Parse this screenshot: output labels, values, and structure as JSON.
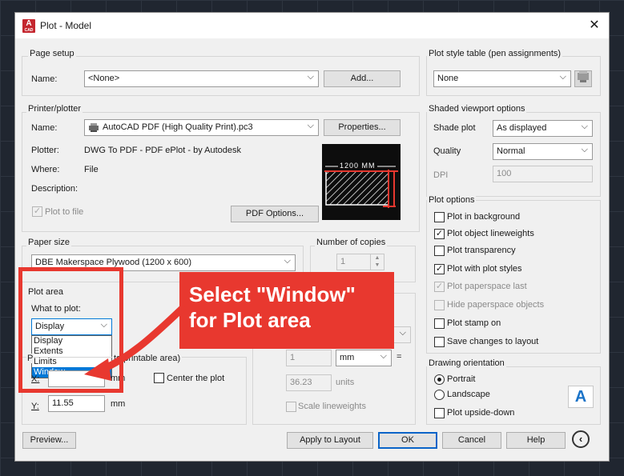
{
  "window": {
    "title": "Plot - Model",
    "app_icon_letter": "A",
    "app_icon_sub": "CAD"
  },
  "page_setup": {
    "group": "Page setup",
    "name_label": "Name:",
    "name_value": "<None>",
    "add_button": "Add..."
  },
  "plot_style": {
    "group": "Plot style table (pen assignments)",
    "value": "None"
  },
  "printer": {
    "group": "Printer/plotter",
    "name_label": "Name:",
    "name_value": "AutoCAD PDF (High Quality Print).pc3",
    "properties_button": "Properties...",
    "plotter_label": "Plotter:",
    "plotter_value": "DWG To PDF - PDF ePlot - by Autodesk",
    "where_label": "Where:",
    "where_value": "File",
    "description_label": "Description:",
    "plot_to_file": "Plot to file",
    "pdf_options_button": "PDF Options...",
    "preview_dimension": "1200 MM"
  },
  "shaded": {
    "group": "Shaded viewport options",
    "shade_label": "Shade plot",
    "shade_value": "As displayed",
    "quality_label": "Quality",
    "quality_value": "Normal",
    "dpi_label": "DPI",
    "dpi_value": "100"
  },
  "paper": {
    "group": "Paper size",
    "value": "DBE Makerspace Plywood (1200 x 600)"
  },
  "copies": {
    "group": "Number of copies",
    "value": "1"
  },
  "plot_options": {
    "group": "Plot options",
    "items": [
      {
        "label": "Plot in background",
        "checked": false,
        "disabled": false
      },
      {
        "label": "Plot object lineweights",
        "checked": true,
        "disabled": false
      },
      {
        "label": "Plot transparency",
        "checked": false,
        "disabled": false
      },
      {
        "label": "Plot with plot styles",
        "checked": true,
        "disabled": false
      },
      {
        "label": "Plot paperspace last",
        "checked": true,
        "disabled": true
      },
      {
        "label": "Hide paperspace objects",
        "checked": false,
        "disabled": true
      },
      {
        "label": "Plot stamp on",
        "checked": false,
        "disabled": false
      },
      {
        "label": "Save changes to layout",
        "checked": false,
        "disabled": false
      }
    ]
  },
  "plot_area": {
    "group": "Plot area",
    "what_label": "What to plot:",
    "value": "Display",
    "options": [
      "Display",
      "Extents",
      "Limits",
      "Window"
    ],
    "selected_option": "Window"
  },
  "offset": {
    "group_prefix": "P",
    "group_suffix": "to printable area)",
    "x_label": "X:",
    "y_label": "Y:",
    "y_value": "11.55",
    "unit": "mm",
    "center_label": "Center the plot"
  },
  "scale": {
    "value_1": "1",
    "unit_value": "mm",
    "equals": "=",
    "value_2": "36.23",
    "units_label": "units",
    "lineweights": "Scale lineweights"
  },
  "orientation": {
    "group": "Drawing orientation",
    "portrait": "Portrait",
    "landscape": "Landscape",
    "upside_down": "Plot upside-down",
    "icon_letter": "A"
  },
  "buttons": {
    "preview": "Preview...",
    "apply": "Apply to Layout",
    "ok": "OK",
    "cancel": "Cancel",
    "help": "Help"
  },
  "callout": {
    "line1": "Select \"Window\"",
    "line2": "for Plot area"
  },
  "colors": {
    "accent": "#e8382f",
    "selection": "#0078d7",
    "default_button": "#0a64c8"
  }
}
